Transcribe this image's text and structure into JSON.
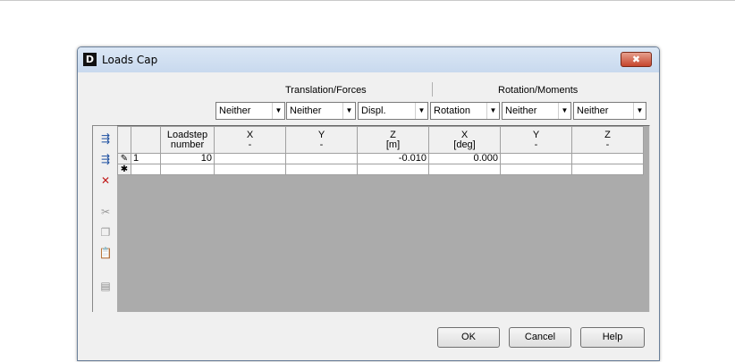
{
  "window": {
    "icon_letter": "D",
    "title": "Loads Cap",
    "close_glyph": "✖"
  },
  "groups": {
    "translation": "Translation/Forces",
    "rotation": "Rotation/Moments"
  },
  "combos": [
    {
      "value": "Neither"
    },
    {
      "value": "Neither"
    },
    {
      "value": "Displ."
    },
    {
      "value": "Rotation"
    },
    {
      "value": "Neither"
    },
    {
      "value": "Neither"
    }
  ],
  "toolbar": [
    {
      "icon": "insert-row-icon",
      "glyph": "⇶"
    },
    {
      "icon": "append-row-icon",
      "glyph": "⇶"
    },
    {
      "icon": "delete-row-icon",
      "glyph": "✕"
    },
    {
      "icon": "cut-icon",
      "glyph": "✂"
    },
    {
      "icon": "copy-icon",
      "glyph": "❐"
    },
    {
      "icon": "paste-icon",
      "glyph": "📋"
    },
    {
      "icon": "fill-icon",
      "glyph": "▤"
    }
  ],
  "grid": {
    "headers": [
      {
        "line1": "Loadstep",
        "line2": "number"
      },
      {
        "line1": "X",
        "line2": "-"
      },
      {
        "line1": "Y",
        "line2": "-"
      },
      {
        "line1": "Z",
        "line2": "[m]"
      },
      {
        "line1": "X",
        "line2": "[deg]"
      },
      {
        "line1": "Y",
        "line2": "-"
      },
      {
        "line1": "Z",
        "line2": "-"
      }
    ],
    "rows": [
      {
        "marker": "✎",
        "id": "1",
        "cells": [
          "10",
          "",
          "",
          "-0.010",
          "0.000",
          "",
          ""
        ]
      },
      {
        "marker": "✱",
        "id": "",
        "cells": [
          "",
          "",
          "",
          "",
          "",
          "",
          ""
        ]
      }
    ]
  },
  "buttons": {
    "ok": "OK",
    "cancel": "Cancel",
    "help": "Help"
  }
}
